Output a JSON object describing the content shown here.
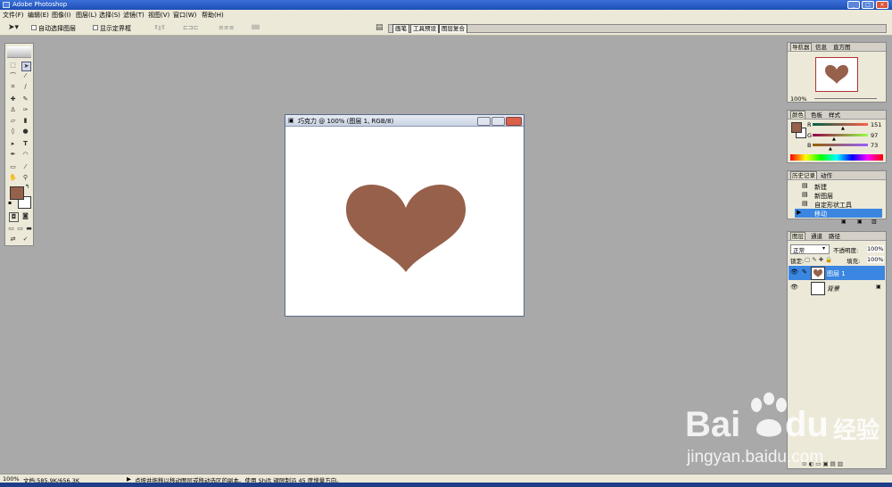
{
  "app": {
    "title": "Adobe Photoshop"
  },
  "window_controls": {
    "minimize": "_",
    "maximize": "□",
    "close": "×"
  },
  "menu": [
    "文件(F)",
    "编辑(E)",
    "图像(I)",
    "图层(L)",
    "选择(S)",
    "滤镜(T)",
    "视图(V)",
    "窗口(W)",
    "帮助(H)"
  ],
  "options_bar": {
    "auto_select_layer": "自动选择图层",
    "show_bounding_box": "显示定界框",
    "well_tabs": [
      "画笔",
      "工具预设",
      "图层复合"
    ]
  },
  "document": {
    "title": "巧克力 @ 100% (图层 1, RGB/8)",
    "shape_color": "#96604b",
    "canvas_color": "#ffffff"
  },
  "navigator": {
    "tabs": [
      "导航器",
      "信息",
      "直方图"
    ],
    "zoom": "100%"
  },
  "color_panel": {
    "tabs": [
      "颜色",
      "色板",
      "样式"
    ],
    "r_label": "R",
    "r_value": "151",
    "g_label": "G",
    "g_value": "97",
    "b_label": "B",
    "b_value": "73",
    "fg_color": "#96614b"
  },
  "history_panel": {
    "tabs": [
      "历史记录",
      "动作"
    ],
    "items": [
      "新建",
      "新图层",
      "自定形状工具",
      "移动"
    ]
  },
  "layers_panel": {
    "tabs": [
      "图层",
      "通道",
      "路径"
    ],
    "blend_mode": "正常",
    "opacity_label": "不透明度:",
    "opacity_value": "100%",
    "lock_label": "锁定:",
    "fill_label": "填充:",
    "fill_value": "100%",
    "layers": [
      {
        "name": "图层 1",
        "selected": true
      },
      {
        "name": "背景",
        "selected": false
      }
    ]
  },
  "status_bar": {
    "zoom": "100%",
    "doc_size": "文档:585.9K/656.3K",
    "hint": "点按并拖移以移动图层或移动选区的副本。使用 Shift 键限制沿 45 度增量方向。"
  },
  "watermark": {
    "brand": "Bai",
    "brand2": "du",
    "cn": "经验",
    "url": "jingyan.baidu.com"
  }
}
